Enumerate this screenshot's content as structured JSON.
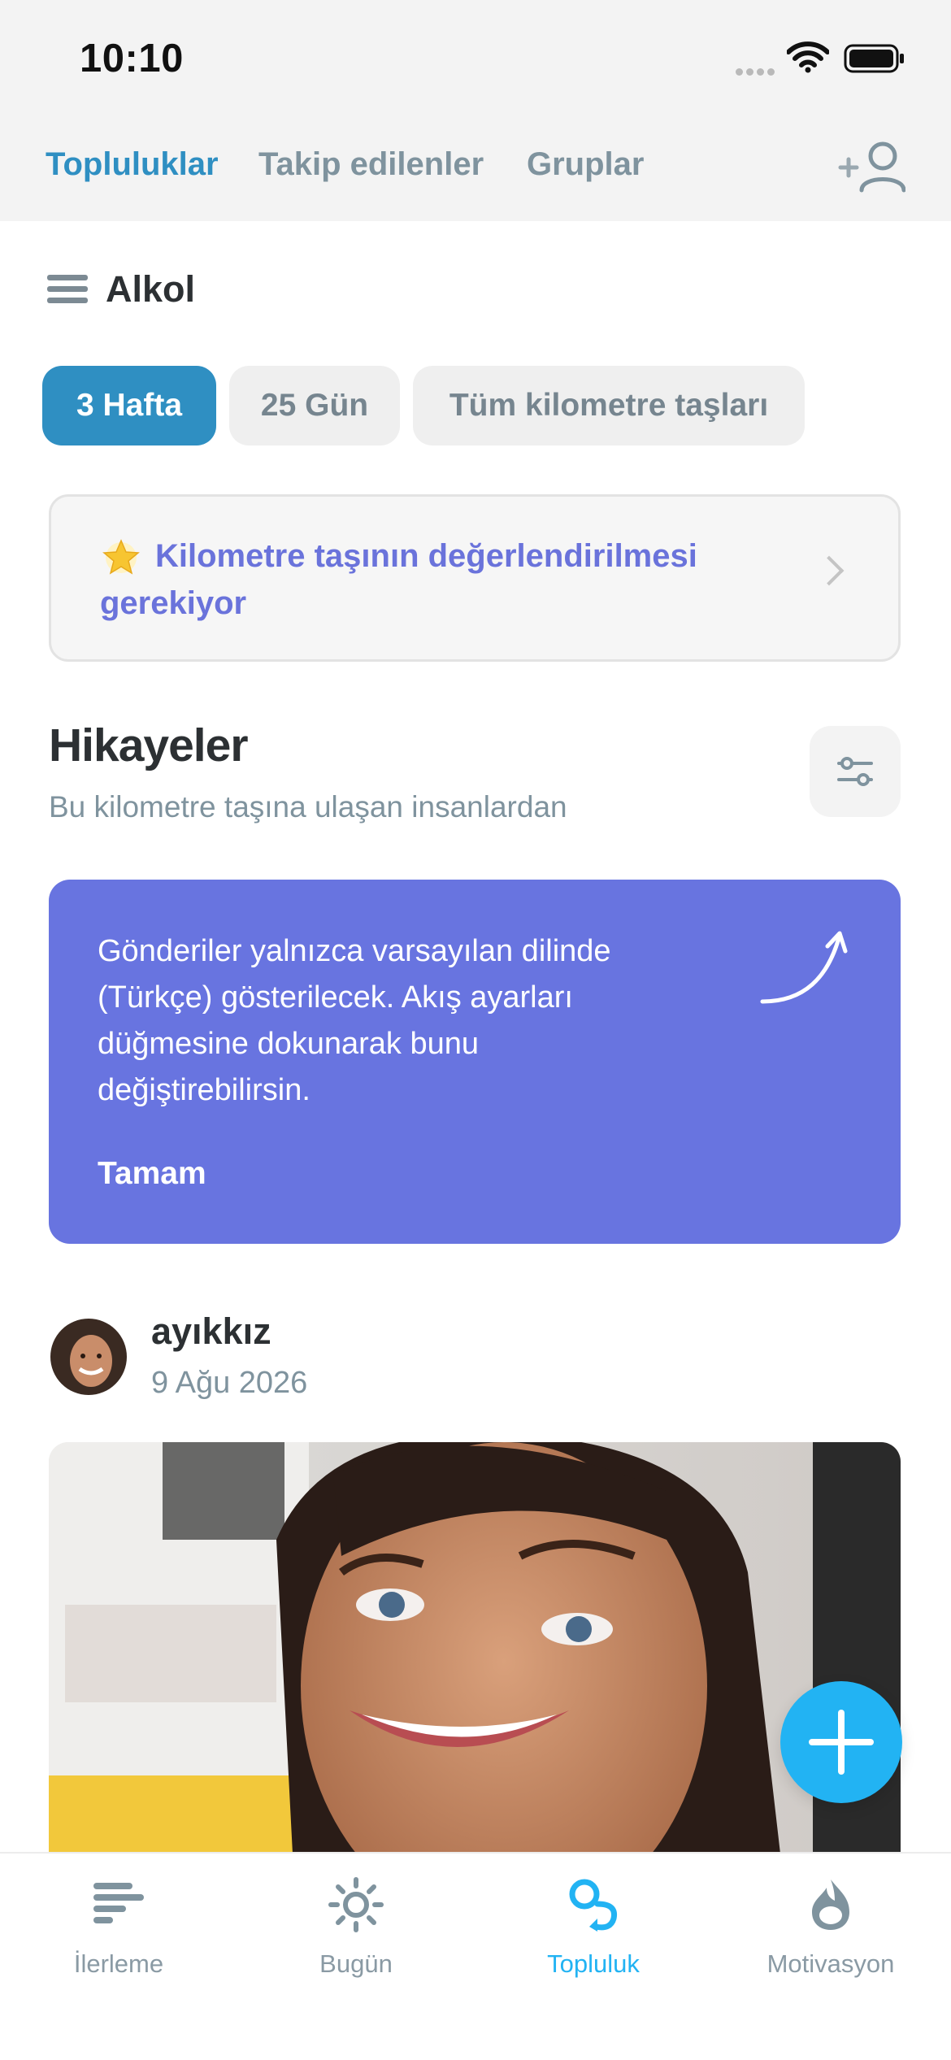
{
  "status_bar": {
    "time": "10:10"
  },
  "top_tabs": [
    {
      "label": "Topluluklar",
      "active": true
    },
    {
      "label": "Takip edilenler",
      "active": false
    },
    {
      "label": "Gruplar",
      "active": false
    }
  ],
  "header": {
    "title": "Alkol",
    "menu_icon": "hamburger-icon",
    "add_person_icon": "add-person-icon"
  },
  "chips": [
    {
      "label": "3 Hafta",
      "active": true
    },
    {
      "label": "25 Gün",
      "active": false
    },
    {
      "label": "Tüm kilometre taşları",
      "active": false
    }
  ],
  "review_banner": {
    "text": "Kilometre taşının değerlendirilmesi gerekiyor",
    "icon": "star-icon"
  },
  "stories": {
    "title": "Hikayeler",
    "subtitle": "Bu kilometre taşına ulaşan insanlardan",
    "filter_icon": "sliders-icon"
  },
  "info_card": {
    "text": "Gönderiler yalnızca varsayılan dilinde (Türkçe) gösterilecek. Akış ayarları düğmesine dokunarak bunu değiştirebilirsin.",
    "ok_label": "Tamam",
    "bg_color": "#6874e0"
  },
  "post": {
    "username": "ayıkkız",
    "date": "9 Ağu 2026"
  },
  "fab": {
    "icon": "plus-icon",
    "color": "#22b3f3"
  },
  "bottom_nav": [
    {
      "label": "İlerleme",
      "icon": "progress-bars-icon",
      "active": false
    },
    {
      "label": "Bugün",
      "icon": "sun-icon",
      "active": false
    },
    {
      "label": "Topluluk",
      "icon": "community-icon",
      "active": true
    },
    {
      "label": "Motivasyon",
      "icon": "motivation-icon",
      "active": false
    }
  ],
  "colors": {
    "accent": "#2f8fc2",
    "link_purple": "#6a73db",
    "muted": "#7f939e"
  }
}
